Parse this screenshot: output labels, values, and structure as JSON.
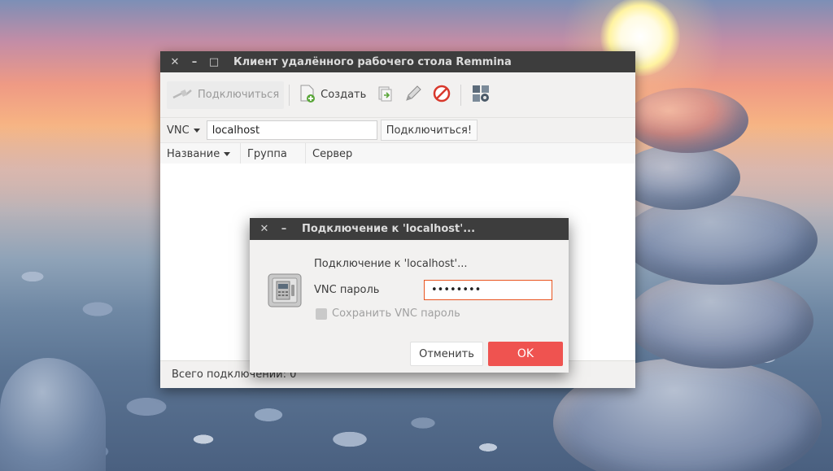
{
  "main_window": {
    "title": "Клиент удалённого рабочего стола Remmina",
    "controls": {
      "close": "✕",
      "minimize": "–",
      "maximize": "□"
    },
    "toolbar": {
      "connect_label": "Подключиться",
      "create_label": "Создать"
    },
    "quick_connect": {
      "protocol": "VNC",
      "host_value": "localhost",
      "connect_button": "Подключиться!"
    },
    "columns": [
      "Название",
      "Группа",
      "Сервер"
    ],
    "status": "Всего подключений: 0"
  },
  "dialog": {
    "title": "Подключение к 'localhost'...",
    "controls": {
      "close": "✕",
      "minimize": "–"
    },
    "heading": "Подключение к 'localhost'...",
    "password_label": "VNC пароль",
    "password_value": "••••••••",
    "save_label": "Сохранить VNC пароль",
    "save_checked": false,
    "cancel_label": "Отменить",
    "ok_label": "OK"
  },
  "colors": {
    "accent": "#ef5350",
    "titlebar": "#3d3d3d",
    "focus_border": "#e95420"
  }
}
